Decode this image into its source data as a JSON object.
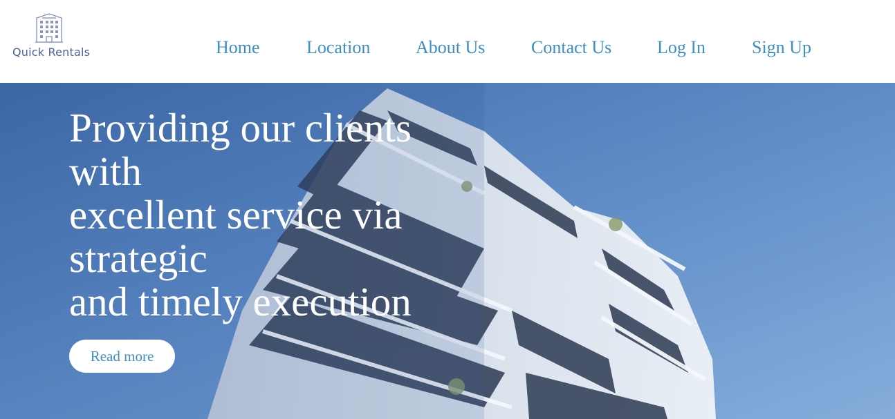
{
  "brand": {
    "name": "Quick Rentals",
    "logo_icon": "building-icon",
    "color": "#4b5fa8"
  },
  "nav": {
    "items": [
      {
        "label": "Home"
      },
      {
        "label": "Location"
      },
      {
        "label": "About Us"
      },
      {
        "label": "Contact Us"
      },
      {
        "label": "Log In"
      },
      {
        "label": "Sign Up"
      }
    ],
    "link_color": "#3c8fc0"
  },
  "hero": {
    "headline_lines": [
      "Providing our clients",
      "with",
      "excellent service via",
      "strategic",
      "and timely execution"
    ],
    "cta_label": "Read more",
    "image": "modern-apartment-building-photo"
  }
}
